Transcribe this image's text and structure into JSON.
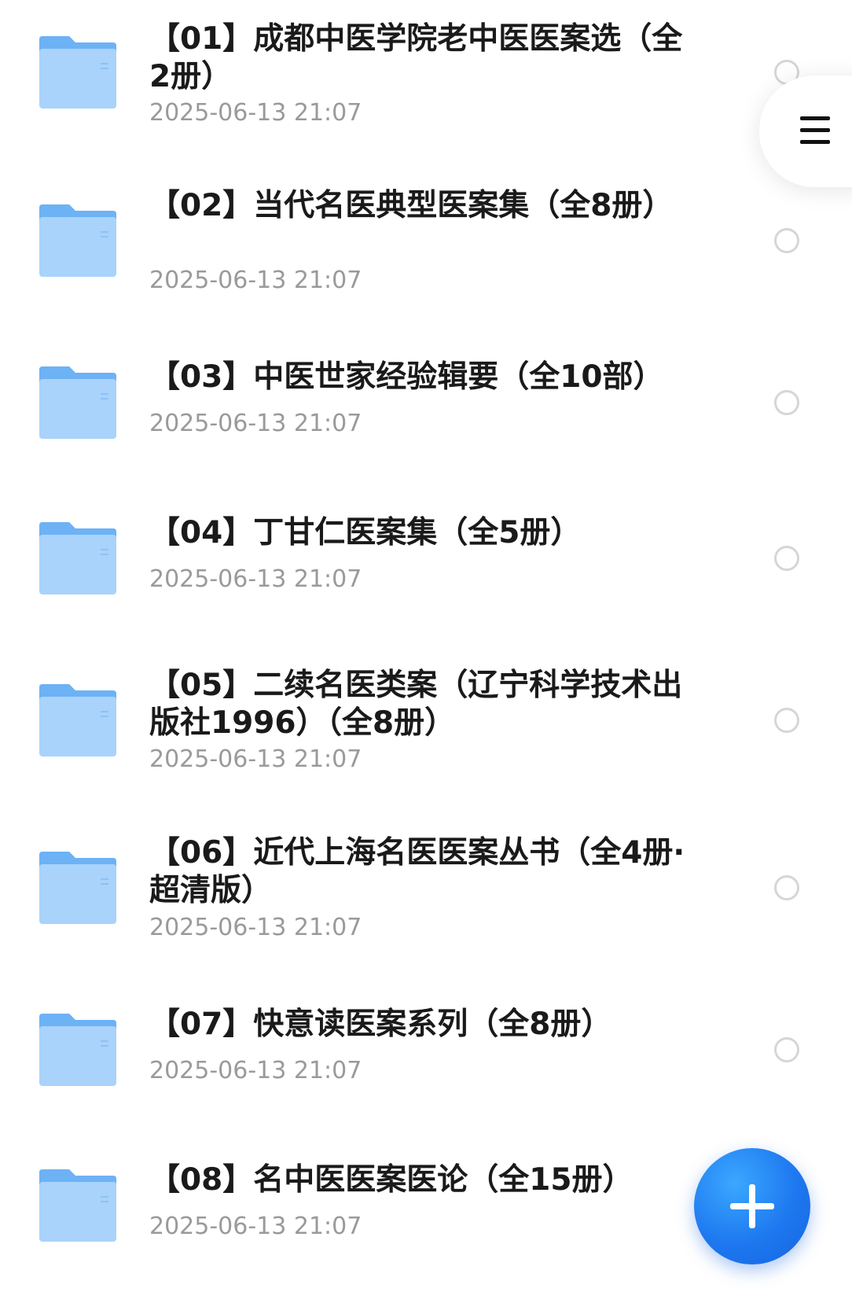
{
  "files": [
    {
      "name": "【01】成都中医学院老中医医案选（全2册）",
      "date": "2025-06-13 21:07",
      "icon": "folder-icon"
    },
    {
      "name": "【02】当代名医典型医案集（全8册）",
      "date": "2025-06-13 21:07",
      "icon": "folder-icon"
    },
    {
      "name": "【03】中医世家经验辑要（全10部）",
      "date": "2025-06-13 21:07",
      "icon": "folder-icon"
    },
    {
      "name": "【04】丁甘仁医案集（全5册）",
      "date": "2025-06-13 21:07",
      "icon": "folder-icon"
    },
    {
      "name": "【05】二续名医类案（辽宁科学技术出版社1996）（全8册）",
      "date": "2025-06-13 21:07",
      "icon": "folder-icon"
    },
    {
      "name": "【06】近代上海名医医案丛书（全4册·超清版）",
      "date": "2025-06-13 21:07",
      "icon": "folder-icon"
    },
    {
      "name": "【07】快意读医案系列（全8册）",
      "date": "2025-06-13 21:07",
      "icon": "folder-icon"
    },
    {
      "name": "【08】名中医医案医论（全15册）",
      "date": "2025-06-13 21:07",
      "icon": "folder-icon"
    }
  ],
  "colors": {
    "folder_light": "#a9d3fb",
    "folder_dark": "#6cb2f5",
    "fab": "#1e78f0",
    "date_text": "#9a9a9a"
  },
  "icons": {
    "menu": "hamburger-menu-icon",
    "fab": "plus-icon",
    "select": "radio-circle-icon"
  }
}
